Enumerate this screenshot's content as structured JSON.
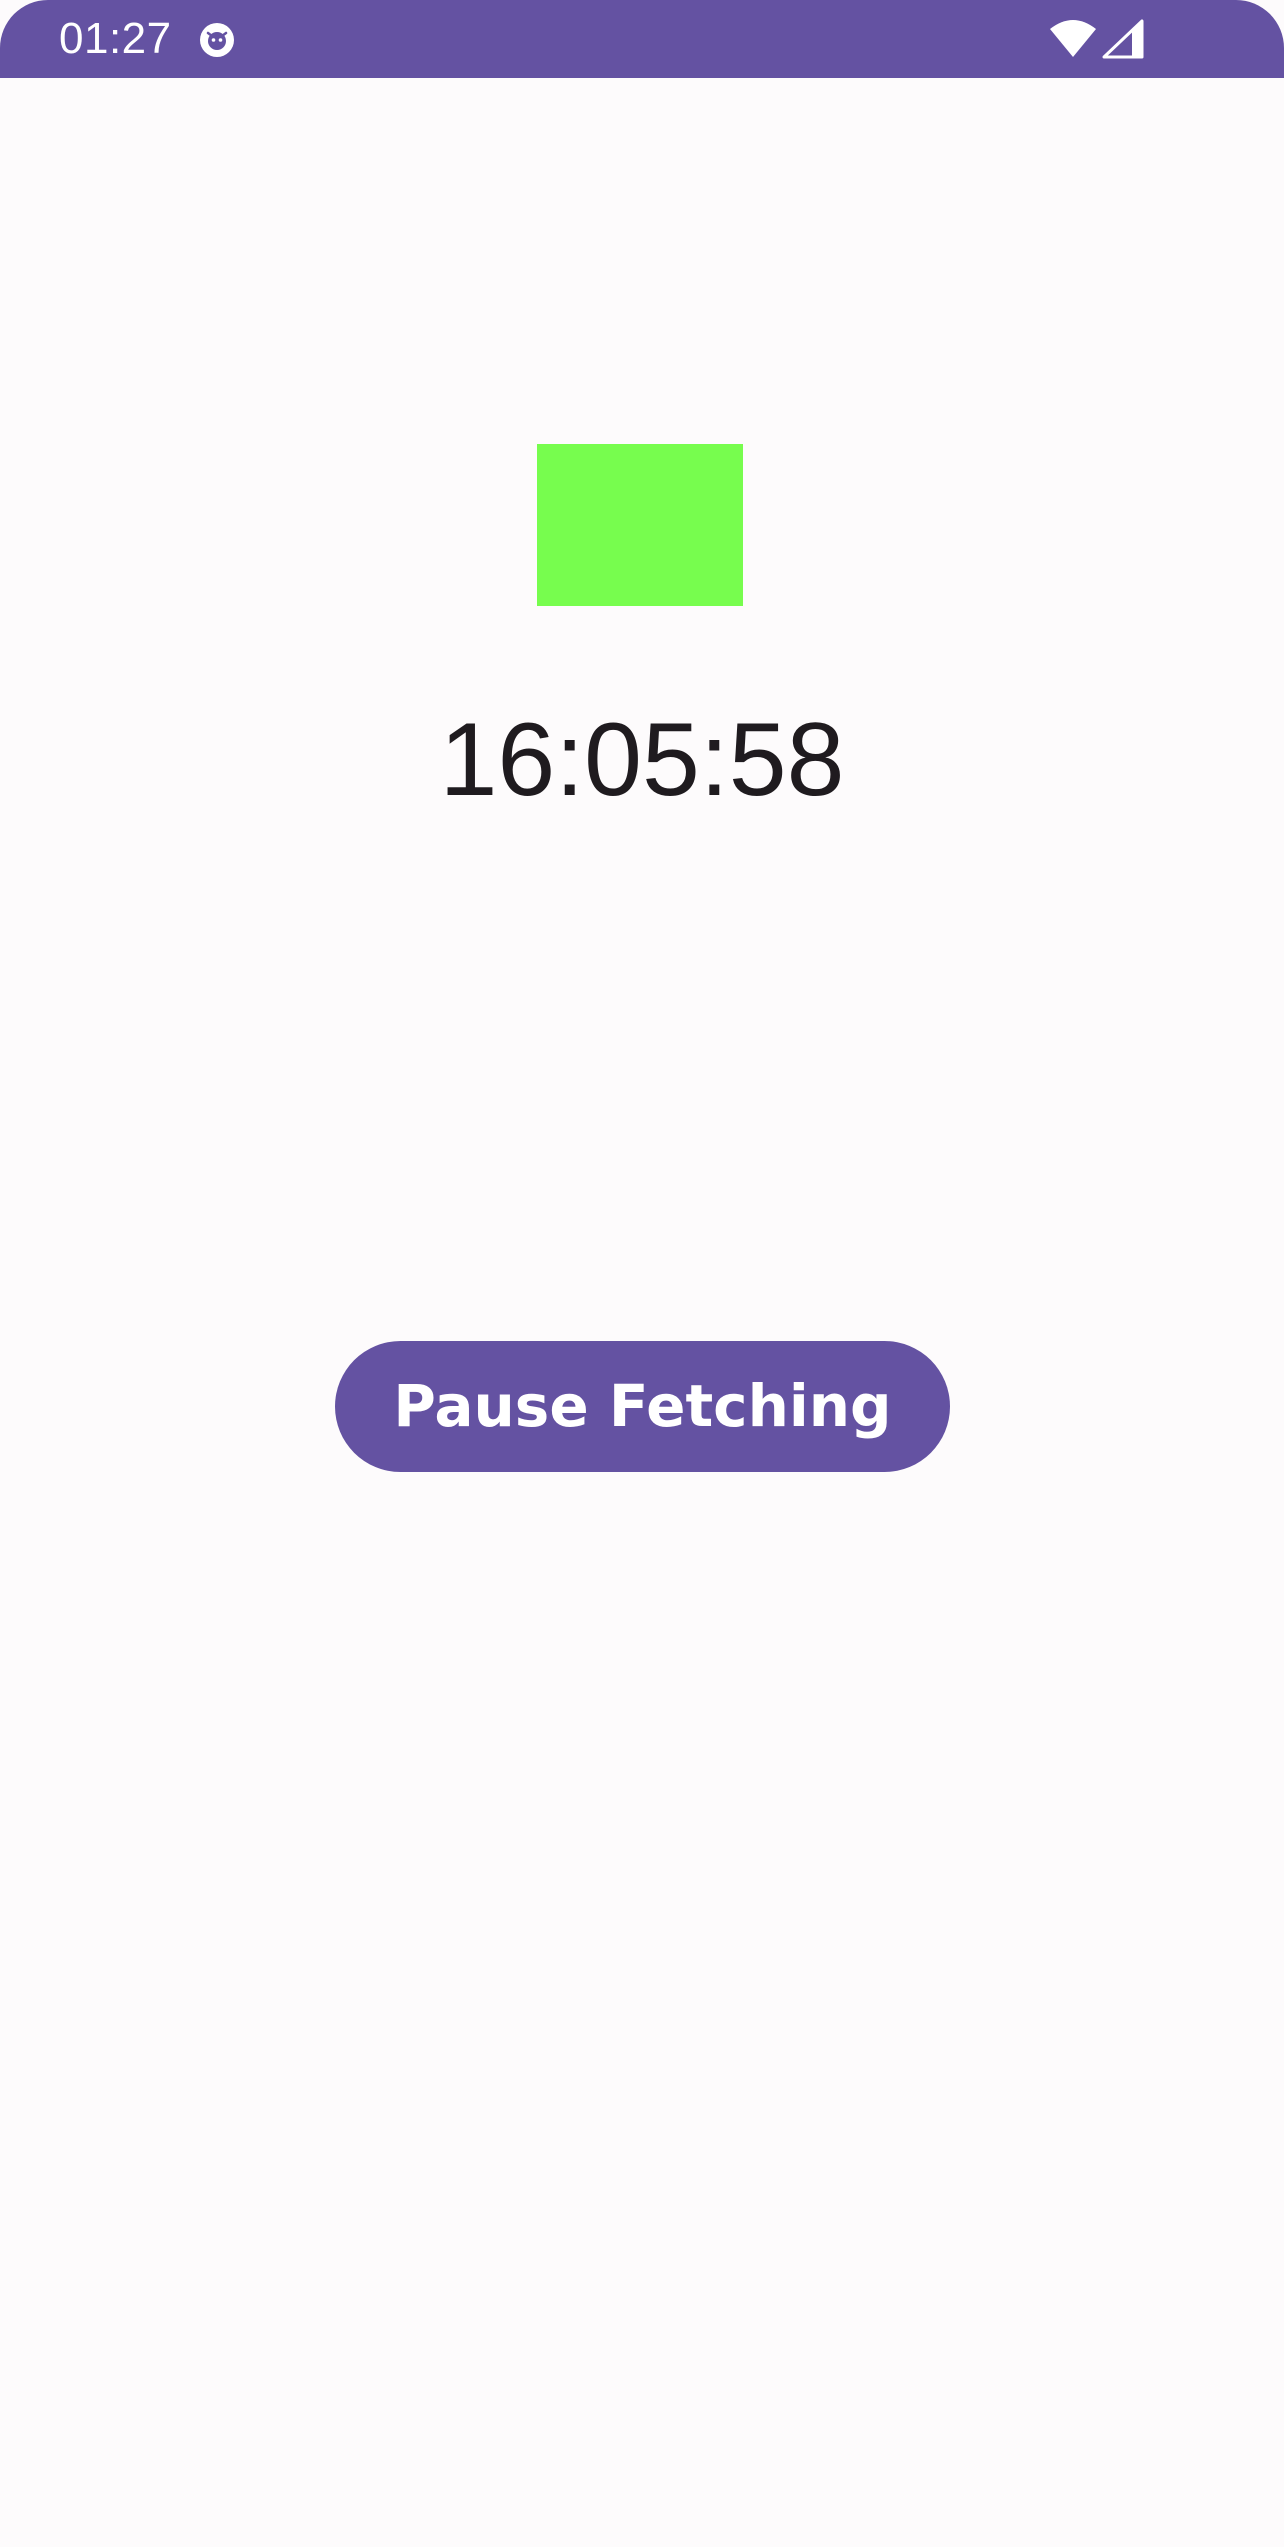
{
  "status_bar": {
    "time": "01:27",
    "app_icon": "app-notification-icon",
    "wifi_icon": "wifi-icon",
    "signal_icon": "cell-signal-icon",
    "color": "#6452A2"
  },
  "main": {
    "color_box": {
      "color": "#77FD4E"
    },
    "clock_text": "16:05:58",
    "pause_button": {
      "label": "Pause Fetching",
      "color": "#6452A2"
    }
  },
  "theme": {
    "background": "#FDFBFC",
    "text": "#1F1B1F"
  }
}
